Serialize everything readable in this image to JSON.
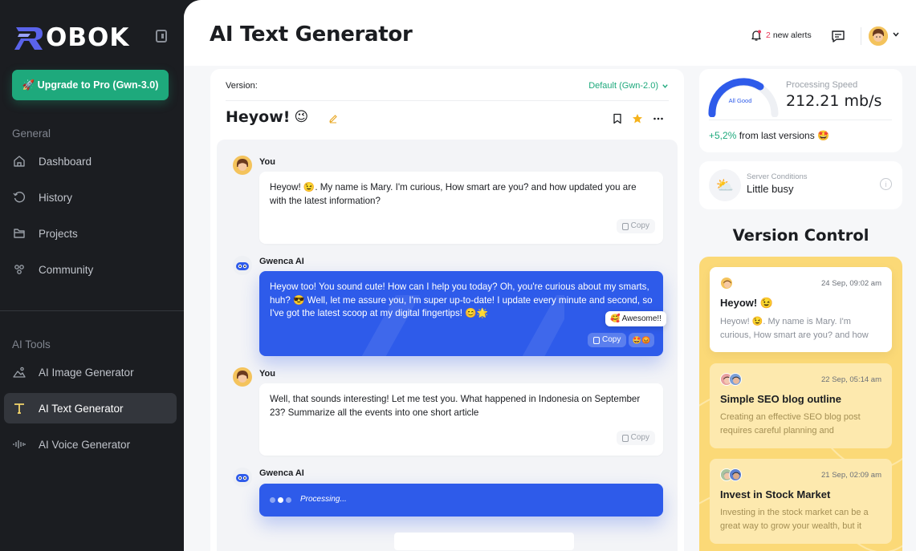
{
  "brand": {
    "name": "OBOK"
  },
  "sidebar": {
    "upgrade_label": "🚀 Upgrade to Pro (Gwn-3.0)",
    "general_label": "General",
    "general_items": [
      {
        "label": "Dashboard",
        "icon": "home-icon"
      },
      {
        "label": "History",
        "icon": "history-icon"
      },
      {
        "label": "Projects",
        "icon": "folder-icon"
      },
      {
        "label": "Community",
        "icon": "community-icon"
      }
    ],
    "tools_label": "AI Tools",
    "tools_items": [
      {
        "label": "AI Image Generator",
        "icon": "image-icon"
      },
      {
        "label": "AI Text Generator",
        "icon": "text-icon",
        "active": true
      },
      {
        "label": "AI Voice Generator",
        "icon": "voice-icon"
      }
    ]
  },
  "header": {
    "title": "AI Text Generator",
    "alerts_count": "2",
    "alerts_text": "new alerts"
  },
  "chat": {
    "version_label": "Version:",
    "version_value": "Default (Gwn-2.0)",
    "title": "Heyow!",
    "title_emoji": "😉",
    "copy_label": "Copy",
    "messages": [
      {
        "author": "You",
        "text": "Heyow! 😉. My name is Mary. I'm curious, How smart are you? and how updated you are with the latest information?"
      },
      {
        "author": "Gwenca AI",
        "text": "Heyow too! You sound cute! How can I help you today? Oh, you're curious about my smarts, huh? 😎 Well, let me assure you, I'm super up-to-date! I update every minute and second, so I've got the latest scoop at my digital fingertips! 😊🌟",
        "reaction_tooltip": "🥰 Awesome!!",
        "reactions": "🤩😡"
      },
      {
        "author": "You",
        "text": "Well, that sounds interesting! Let me test you. What happened in Indonesia on September 23? Summarize all the events into one short article"
      },
      {
        "author": "Gwenca AI",
        "text": "Processing..."
      }
    ]
  },
  "speed": {
    "gauge_label": "All Good",
    "title": "Processing Speed",
    "value": "212.21 mb/s",
    "delta_pct": "+5,2%",
    "delta_text": " from last versions 🤩"
  },
  "server": {
    "emoji": "⛅",
    "label": "Server Conditions",
    "value": "Little busy",
    "info": "i"
  },
  "version_control": {
    "title": "Version Control",
    "items": [
      {
        "date": "24 Sep, 09:02 am",
        "title": "Heyow! 😉",
        "snippet": "Heyow! 😉. My name is Mary. I'm curious, How smart are you? and how updated you are",
        "selected": true
      },
      {
        "date": "22 Sep, 05:14 am",
        "title": "Simple SEO blog outline",
        "snippet": "Creating an effective SEO blog post requires careful planning and organization",
        "selected": false
      },
      {
        "date": "21 Sep, 02:09 am",
        "title": "Invest in Stock Market",
        "snippet": "Investing in the stock market can be a great way to grow your wealth, but it requires",
        "selected": false
      }
    ]
  },
  "colors": {
    "accent_green": "#1ea97c",
    "accent_blue": "#2e5bea",
    "vc_yellow": "#fbd977",
    "sidebar_bg": "#1b1d21"
  }
}
